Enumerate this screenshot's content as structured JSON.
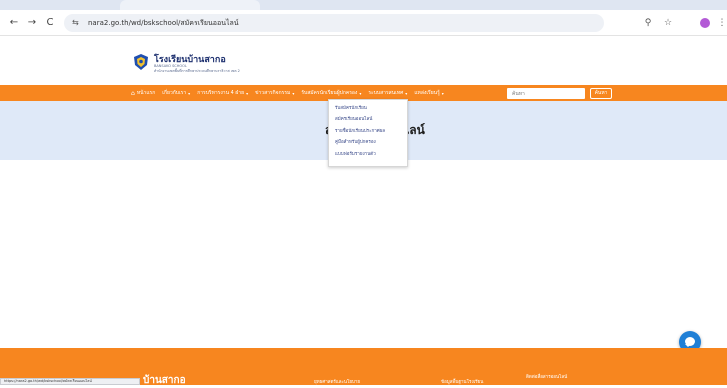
{
  "browser": {
    "url": "nara2.go.th/wd/bskschool/สมัครเรียนออนไลน์",
    "back_glyph": "←",
    "forward_glyph": "→",
    "reload_glyph": "C",
    "site_info_glyph": "⇆",
    "zoom_glyph": "⚲",
    "star_glyph": "☆",
    "menu_glyph": "⋮"
  },
  "header": {
    "school_name": "โรงเรียนบ้านสากอ",
    "subtitle_line1": "BANSAKO SCHOOL",
    "subtitle_line2": "สำนักงานเขตพื้นที่การศึกษาประถมศึกษานราธิวาส เขต 2"
  },
  "navbar": {
    "home_glyph": "⌂",
    "caret_glyph": "▾",
    "items": [
      {
        "label": "หน้าแรก",
        "has_caret": false
      },
      {
        "label": "เกี่ยวกับเรา",
        "has_caret": true
      },
      {
        "label": "การบริหารงาน 4 ฝ่าย",
        "has_caret": true
      },
      {
        "label": "ข่าวสารกิจกรรม",
        "has_caret": true
      },
      {
        "label": "รับสมัครนักเรียนผู้ปกครอง",
        "has_caret": true
      },
      {
        "label": "ระบบสารสนเทศ",
        "has_caret": true
      },
      {
        "label": "แหล่งเรียนรู้",
        "has_caret": true
      }
    ],
    "search_placeholder": "ค้นหา",
    "search_button": "ค้นหา"
  },
  "hero": {
    "title": "สมัครเรียนออนไลน์"
  },
  "dropdown": {
    "items": [
      "รับสมัครนักเรียน",
      "สมัครเรียนออนไลน์",
      "รายชื่อนักเรียนประกาศผล",
      "คู่มือสำหรับผู้ปกครอง",
      "แบบฟอร์มรายงานตัว"
    ]
  },
  "footer": {
    "brand": "บ้านสากอ",
    "link1": "ยุทธศาสตร์และนโยบาย",
    "link2": "ข้อมูลพื้นฐานโรงเรียน",
    "link3": "ติดต่อสื่อสารออนไลน์"
  },
  "status_bar": {
    "text": "https://nara2.go.th/wd/bskschool/สมัครเรียนออนไลน์"
  },
  "colors": {
    "accent_orange": "#f7861f",
    "hero_bg": "#dfe9f8",
    "chat_blue": "#1f7fd6"
  }
}
